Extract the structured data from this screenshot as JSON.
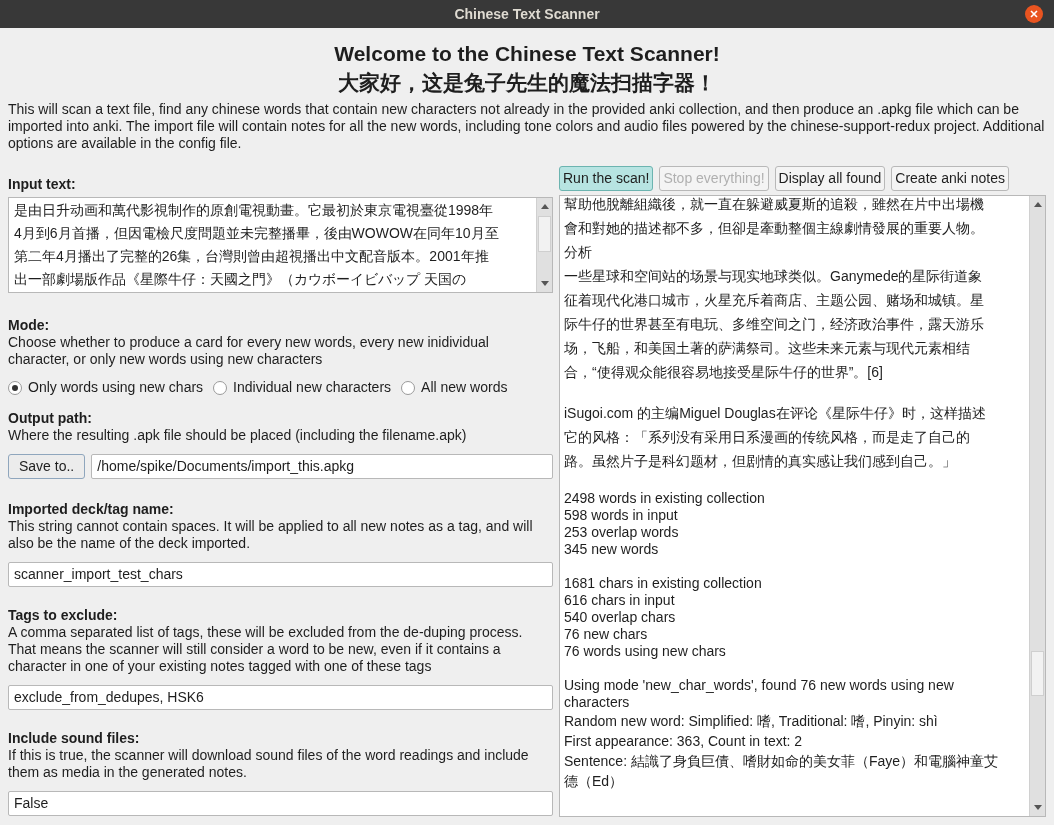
{
  "window": {
    "title": "Chinese Text Scanner"
  },
  "header": {
    "title": "Welcome to the Chinese Text Scanner!",
    "subtitle": "大家好，这是兔子先生的魔法扫描字器！",
    "description": "This will scan a text file, find any chinese words that contain new characters not already in the provided anki collection, and then produce an .apkg file which can be imported into anki. The import file will contain notes for all the new words, including tone colors and audio files powered by the chinese-support-redux project. Additional options are available in the config file."
  },
  "input_text": {
    "label": "Input text:",
    "lines": [
      "是由日升动画和萬代影視制作的原創電視動畫。它最初於東京電視臺從1998年",
      "4月到6月首播，但因電檢尺度問題並未完整播畢，後由WOWOW在同年10月至",
      "第二年4月播出了完整的26集，台灣則曾由超視播出中文配音版本。2001年推",
      "出一部劇場版作品《星際牛仔：天國之門》（カウボーイビバップ 天国の"
    ]
  },
  "mode": {
    "label": "Mode:",
    "description": "Choose whether to produce a card for every new words, every new inidividual character, or only new words using new characters",
    "options": [
      {
        "label": "Only words using new chars",
        "selected": true
      },
      {
        "label": "Individual new characters",
        "selected": false
      },
      {
        "label": "All new words",
        "selected": false
      }
    ]
  },
  "output_path": {
    "label": "Output path:",
    "description": "Where the resulting .apk file should be placed (including the filename.apk)",
    "button": "Save to..",
    "value": "/home/spike/Documents/import_this.apkg"
  },
  "deck": {
    "label": "Imported deck/tag name:",
    "description": "This string cannot contain spaces. It will be applied to all new notes as a tag, and will also be the name of the deck imported.",
    "value": "scanner_import_test_chars"
  },
  "tags_exclude": {
    "label": "Tags to exclude:",
    "description": "A comma separated list of tags, these will be excluded from the de-duping process. That means the scanner will still consider a word to be new, even if it contains a character in one of your existing notes tagged with one of these tags",
    "value": "exclude_from_dedupes, HSK6"
  },
  "sound": {
    "label": "Include sound files:",
    "description": "If this is true, the scanner will download sound files of the word readings and include them as media in the generated notes.",
    "value": "False"
  },
  "buttons": [
    {
      "label": "Run the scan!",
      "focused": true,
      "disabled": false
    },
    {
      "label": "Stop everything!",
      "focused": false,
      "disabled": true
    },
    {
      "label": "Display all found",
      "focused": false,
      "disabled": false
    },
    {
      "label": "Create anki notes",
      "focused": false,
      "disabled": false
    }
  ],
  "output": {
    "blocks": [
      {
        "kind": "cjk",
        "lines": [
          "幫助他脫離組織後，就一直在躲避威夏斯的追殺，雖然在片中出場機",
          "會和對她的描述都不多，但卻是牽動整個主線劇情發展的重要人物。",
          "分析",
          "一些星球和空间站的场景与现实地球类似。Ganymede的星际街道象",
          "征着现代化港口城市，火星充斥着商店、主题公园、赌场和城镇。星",
          "际牛仔的世界甚至有电玩、多维空间之门，经济政治事件，露天游乐",
          "场，飞船，和美国土著的萨满祭司。这些未来元素与现代元素相结",
          "合，“使得观众能很容易地接受星际牛仔的世界”。[6]"
        ]
      },
      {
        "kind": "cjk",
        "lines": [
          "iSugoi.com 的主编Miguel Douglas在评论《星际牛仔》时，这样描述",
          "它的风格：「系列没有采用日系漫画的传统风格，而是走了自己的",
          "路。虽然片子是科幻题材，但剧情的真实感让我们感到自己。」"
        ]
      },
      {
        "kind": "plain",
        "lines": [
          "2498 words in existing collection",
          "598 words in input",
          "253 overlap words",
          "345 new words"
        ]
      },
      {
        "kind": "plain",
        "lines": [
          "1681 chars in existing collection",
          "616 chars in input",
          "540 overlap chars",
          "76 new chars",
          "76 words using new chars"
        ]
      },
      {
        "kind": "mixed",
        "lines": [
          "Using mode 'new_char_words', found 76 new words using new",
          "characters",
          "Random new word: Simplified: 嗜, Traditional: 嗜, Pinyin: shì",
          "First appearance: 363, Count in text: 2",
          "Sentence: 結識了身負巨債、嗜財如命的美女菲（Faye）和電腦神童艾",
          "德（Ed）"
        ]
      }
    ]
  }
}
